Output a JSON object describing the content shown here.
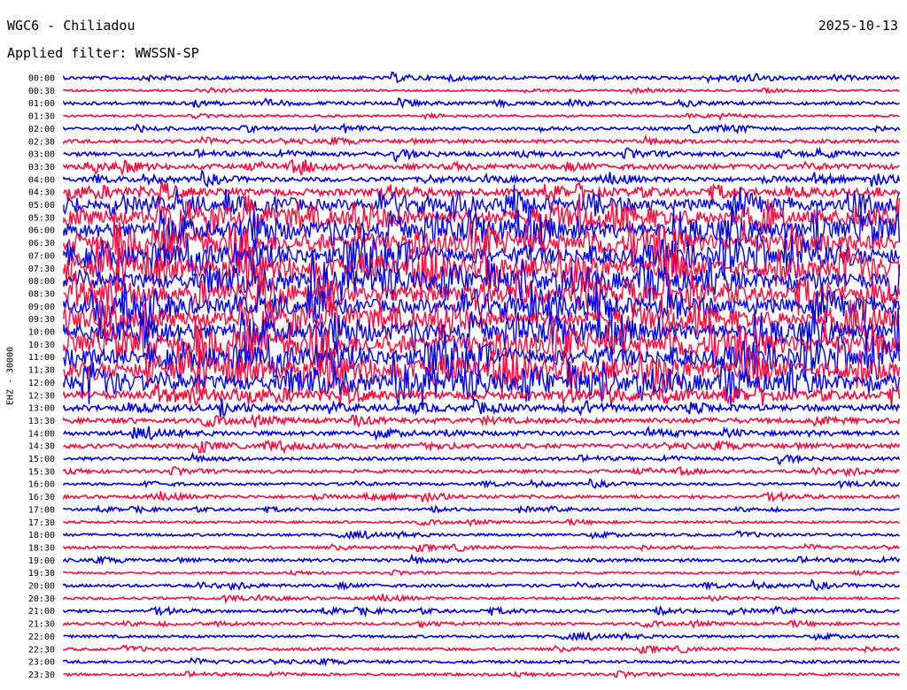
{
  "header": {
    "station": "WGC6 - Chiliadou",
    "date": "2025-10-13",
    "filter": "Applied filter: WWSSN-SP"
  },
  "chart_data": {
    "type": "line",
    "title": "WGC6 - Chiliadou",
    "subtitle": "Applied filter: WWSSN-SP",
    "xlabel": "",
    "ylabel": "EHZ - 30000",
    "y_tick_labels": [
      "00:00",
      "00:30",
      "01:00",
      "01:30",
      "02:00",
      "02:30",
      "03:00",
      "03:30",
      "04:00",
      "04:30",
      "05:00",
      "05:30",
      "06:00",
      "06:30",
      "07:00",
      "07:30",
      "08:00",
      "08:30",
      "09:00",
      "09:30",
      "10:00",
      "10:30",
      "11:00",
      "11:30",
      "12:00",
      "12:30",
      "13:00",
      "13:30",
      "14:00",
      "14:30",
      "15:00",
      "15:30",
      "16:00",
      "16:30",
      "17:00",
      "17:30",
      "18:00",
      "18:30",
      "19:00",
      "19:30",
      "20:00",
      "20:30",
      "21:00",
      "21:30",
      "22:00",
      "22:30",
      "23:00",
      "23:30"
    ],
    "series_colors": [
      "#0000ee",
      "#ff0a3c"
    ],
    "activity": [
      0.6,
      0.2,
      0.6,
      0.2,
      0.5,
      0.7,
      0.9,
      1.2,
      1.0,
      1.8,
      3.2,
      4.2,
      4.5,
      4.5,
      4.6,
      4.6,
      4.5,
      4.3,
      4.4,
      4.4,
      4.6,
      4.7,
      4.6,
      4.6,
      4.3,
      2.0,
      1.5,
      1.2,
      1.0,
      1.0,
      0.6,
      0.6,
      0.4,
      0.6,
      0.3,
      0.3,
      0.4,
      0.4,
      0.6,
      0.2,
      0.5,
      0.4,
      0.5,
      0.4,
      0.4,
      0.4,
      0.5,
      0.4
    ],
    "grid": false,
    "legend": "none"
  }
}
